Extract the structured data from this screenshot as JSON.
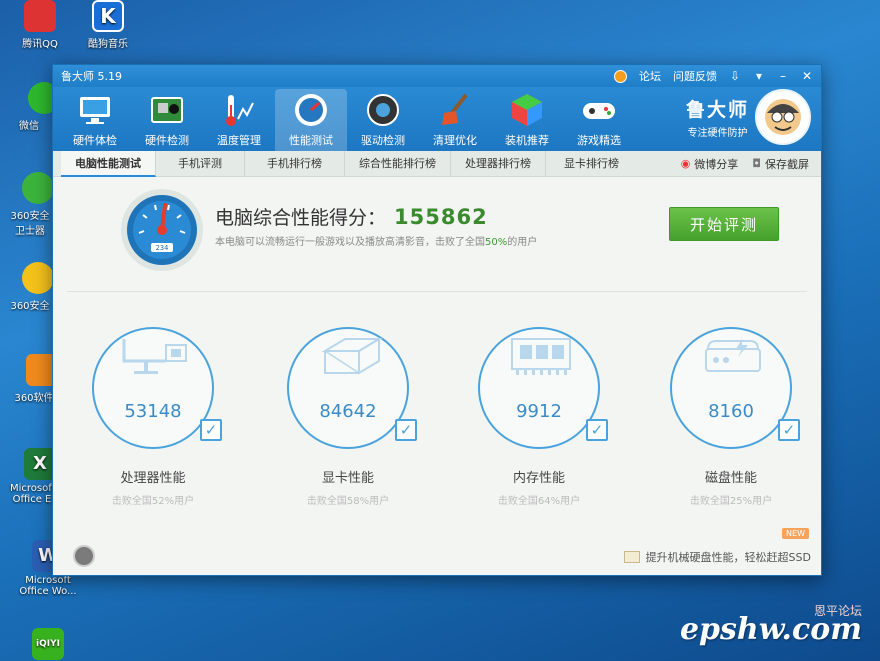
{
  "desktop": {
    "icons": [
      "腾讯QQ",
      "酷狗音乐",
      "微信",
      "360安全卫士器",
      "360安全",
      "360软件",
      "Microsoft Office E",
      "Microsoft Office Wo...",
      "iQIYI"
    ]
  },
  "window": {
    "title": "鲁大师 5.19",
    "titlebar_links": [
      "论坛",
      "问题反馈"
    ],
    "toolbar": [
      {
        "label": "硬件体检",
        "icon": "monitor-icon"
      },
      {
        "label": "硬件检测",
        "icon": "board-icon"
      },
      {
        "label": "温度管理",
        "icon": "thermometer-icon"
      },
      {
        "label": "性能测试",
        "icon": "speedometer-icon",
        "active": true
      },
      {
        "label": "驱动检测",
        "icon": "gear-icon"
      },
      {
        "label": "清理优化",
        "icon": "broom-icon"
      },
      {
        "label": "装机推荐",
        "icon": "cube-icon"
      },
      {
        "label": "游戏精选",
        "icon": "gamepad-icon"
      }
    ],
    "brand": {
      "name": "鲁大师",
      "slogan": "专注硬件防护"
    }
  },
  "subtabs": [
    "电脑性能测试",
    "手机评测",
    "手机排行榜",
    "综合性能排行榜",
    "处理器排行榜",
    "显卡排行榜"
  ],
  "subtab_actions": {
    "share": "微博分享",
    "save": "保存截屏"
  },
  "score": {
    "title": "电脑综合性能得分：",
    "value": "155862",
    "desc_prefix": "本电脑可以流畅运行一般游戏以及播放高清影音，击败了全国",
    "desc_pct": "50%",
    "desc_suffix": "的用户",
    "gauge_value": "234",
    "start_button": "开始评测"
  },
  "metrics": [
    {
      "value": "53148",
      "label": "处理器性能",
      "sub": "击败全国52%用户"
    },
    {
      "value": "84642",
      "label": "显卡性能",
      "sub": "击败全国58%用户"
    },
    {
      "value": "9912",
      "label": "内存性能",
      "sub": "击败全国64%用户"
    },
    {
      "value": "8160",
      "label": "磁盘性能",
      "sub": "击败全国25%用户"
    }
  ],
  "footer": {
    "tip": "提升机械硬盘性能，轻松赶超SSD",
    "new_tag": "NEW"
  },
  "watermark": {
    "text": "epshw.com",
    "cn": "恩平论坛"
  },
  "colors": {
    "accent": "#2a8ad4",
    "score_green": "#3a8a2e",
    "start_green": "#52ad36"
  }
}
